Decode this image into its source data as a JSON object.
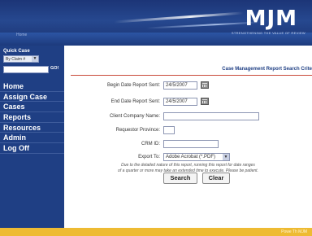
{
  "header": {
    "logo": "MJM",
    "tagline": "STRENGTHENING THE VALUE OF REVIEW",
    "home_link": "Home"
  },
  "sidebar": {
    "quick_case": {
      "title": "Quick Case",
      "select_value": "By Claim #",
      "go_label": "GO!"
    },
    "nav": [
      {
        "label": "Home"
      },
      {
        "label": "Assign Case"
      },
      {
        "label": "Cases"
      },
      {
        "label": "Reports"
      },
      {
        "label": "Resources"
      },
      {
        "label": "Admin"
      },
      {
        "label": "Log Off"
      }
    ]
  },
  "main": {
    "title": "Case Management Report Search Crite",
    "fields": {
      "begin_date": {
        "label": "Begin Date Report Sent:",
        "value": "24/5/2007"
      },
      "end_date": {
        "label": "End Date Report Sent:",
        "value": "24/5/2007"
      },
      "client_company": {
        "label": "Client Company Name:",
        "value": ""
      },
      "requestor_province": {
        "label": "Requestor Province:",
        "value": ""
      },
      "crm_id": {
        "label": "CRM ID:",
        "value": ""
      },
      "export_to": {
        "label": "Export To:",
        "value": "Adobe Acrobat (*.PDF)"
      }
    },
    "note_lines": [
      "Due to the detailed nature of this report, running this report for date ranges",
      "of a quarter or more may take an extended time to execute. Please be patient."
    ],
    "buttons": {
      "search": "Search",
      "clear": "Clear"
    }
  },
  "footer": {
    "text": "Powe Th  MJM"
  },
  "colors": {
    "header_blue": "#1c3577",
    "sidebar_blue": "#1f3f84",
    "rule_red": "#c94a3a",
    "footer_gold": "#eebb33"
  }
}
